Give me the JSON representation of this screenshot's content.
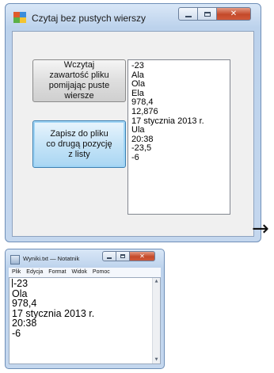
{
  "form_window": {
    "title": "Czytaj bez pustych wierszy",
    "caption": {
      "minimize": "",
      "maximize": "",
      "close": "✕"
    },
    "buttons": {
      "load": "Wczytaj\nzawartość pliku\npomijając puste\nwiersze",
      "save": "Zapisz do pliku\nco drugą pozycję\nz listy"
    },
    "listbox_items": [
      "-23",
      "Ala",
      "Ola",
      "Ela",
      "978,4",
      "12,876",
      "17 stycznia 2013 r.",
      "Ula",
      "20:38",
      "-23,5",
      "-6"
    ]
  },
  "arrow": "→",
  "notepad_window": {
    "title": "Wyniki.txt — Notatnik",
    "caption": {
      "minimize": "",
      "maximize": "",
      "close": "✕"
    },
    "menu": [
      "Plik",
      "Edycja",
      "Format",
      "Widok",
      "Pomoc"
    ],
    "lines": [
      "-23",
      "Ola",
      "978,4",
      "17 stycznia 2013 r.",
      "20:38",
      "-6"
    ],
    "scroll": {
      "up": "▲",
      "down": "▼"
    }
  },
  "icons": {
    "app_icon": "winforms-app-icon",
    "notepad_icon": "notepad-icon",
    "arrow": "arrow-right-icon"
  }
}
